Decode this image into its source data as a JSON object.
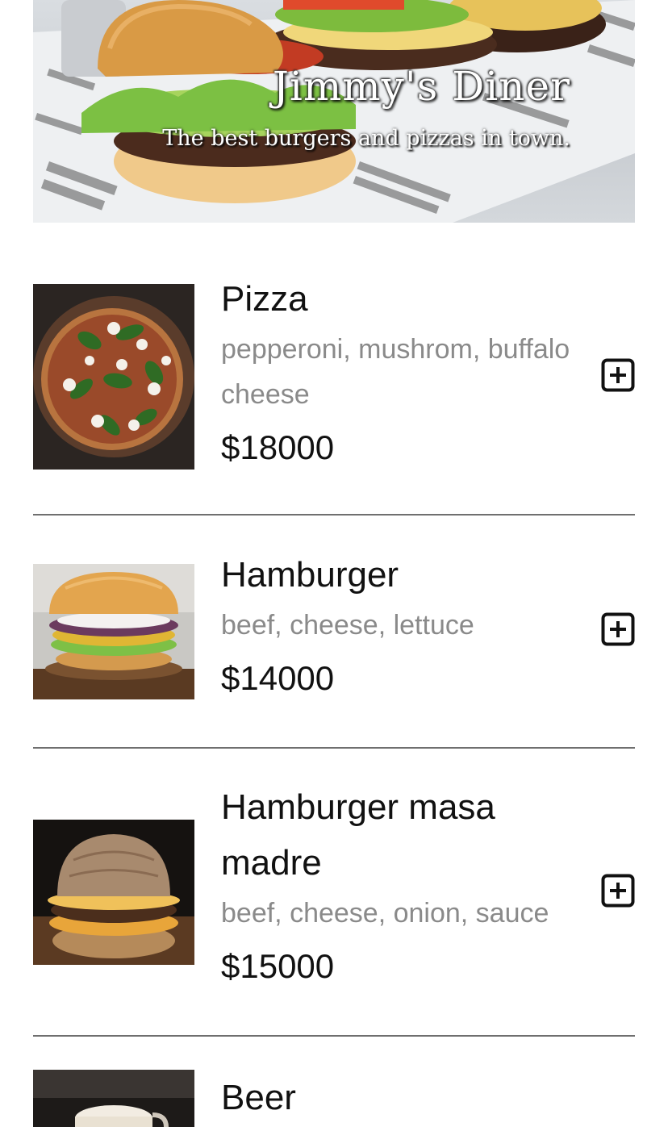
{
  "hero": {
    "title": "Jimmy's Diner",
    "subtitle": "The best burgers and pizzas in town."
  },
  "menu": {
    "items": [
      {
        "name": "Pizza",
        "ingredients": "pepperoni, mushrom, buffalo cheese",
        "price": "$18000",
        "image_icon": "pizza-photo",
        "add_icon": "plus-square-icon"
      },
      {
        "name": "Hamburger",
        "ingredients": "beef, cheese, lettuce",
        "price": "$14000",
        "image_icon": "hamburger-photo",
        "add_icon": "plus-square-icon"
      },
      {
        "name": "Hamburger masa madre",
        "ingredients": "beef, cheese, onion, sauce",
        "price": "$15000",
        "image_icon": "hamburger-masa-madre-photo",
        "add_icon": "plus-square-icon"
      },
      {
        "name": "Beer",
        "ingredients": "",
        "price": "",
        "image_icon": "beer-photo",
        "add_icon": "plus-square-icon"
      }
    ]
  },
  "colors": {
    "text": "#111111",
    "muted_text": "#8a8a8a",
    "divider": "#6f6f6f",
    "background": "#ffffff"
  }
}
